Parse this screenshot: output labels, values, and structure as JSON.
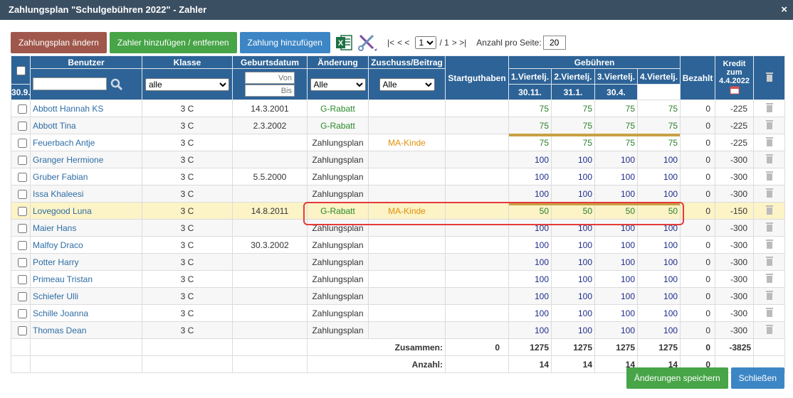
{
  "window": {
    "title": "Zahlungsplan \"Schulgebühren 2022\" - Zahler",
    "close_symbol": "×"
  },
  "toolbar": {
    "btn_change_plan": "Zahlungsplan ändern",
    "btn_add_remove": "Zahler hinzufügen / entfernen",
    "btn_add_payment": "Zahlung hinzufügen",
    "excel_icon": "excel-icon",
    "tools_icon": "tools-icon",
    "pager_first": "|<",
    "pager_prev": "< <",
    "page_current": "1",
    "page_total": "/ 1",
    "pager_next": "> >|",
    "per_page_label": "Anzahl pro Seite:",
    "per_page_value": "20"
  },
  "headers": {
    "benutzer": "Benutzer",
    "klasse": "Klasse",
    "geburtsdatum": "Geburtsdatum",
    "aenderung": "Änderung",
    "zuschuss": "Zuschuss/Beitrag",
    "startguthaben": "Startguthaben",
    "gebuehren": "Gebühren",
    "q1": "1.Viertelj.",
    "q1d": "30.9.",
    "q2": "2.Viertelj.",
    "q2d": "30.11.",
    "q3": "3.Viertelj.",
    "q3d": "31.1.",
    "q4": "4.Viertelj.",
    "q4d": "30.4.",
    "bezahlt": "Bezahlt",
    "kredit": "Kredit zum",
    "kredit_date": "4.4.2022"
  },
  "filters": {
    "klasse": "alle",
    "date_from": "Von",
    "date_to": "Bis",
    "aenderung": "Alle",
    "zuschuss": "Alle"
  },
  "rows": [
    {
      "name": "Abbott Hannah KS",
      "klasse": "3 C",
      "geb": "14.3.2001",
      "aend": "G-Rabatt",
      "zus": "",
      "q": [
        "75",
        "75",
        "75",
        "75"
      ],
      "bezahlt": "0",
      "kredit": "-225"
    },
    {
      "name": "Abbott Tina",
      "klasse": "3 C",
      "geb": "2.3.2002",
      "aend": "G-Rabatt",
      "zus": "",
      "q": [
        "75",
        "75",
        "75",
        "75"
      ],
      "bezahlt": "0",
      "kredit": "-225"
    },
    {
      "name": "Feuerbach Antje",
      "klasse": "3 C",
      "geb": "",
      "aend": "Zahlungsplan",
      "zus": "MA-Kinde",
      "q": [
        "75",
        "75",
        "75",
        "75"
      ],
      "bezahlt": "0",
      "kredit": "-225"
    },
    {
      "name": "Granger Hermione",
      "klasse": "3 C",
      "geb": "",
      "aend": "Zahlungsplan",
      "zus": "",
      "q": [
        "100",
        "100",
        "100",
        "100"
      ],
      "bezahlt": "0",
      "kredit": "-300"
    },
    {
      "name": "Gruber Fabian",
      "klasse": "3 C",
      "geb": "5.5.2000",
      "aend": "Zahlungsplan",
      "zus": "",
      "q": [
        "100",
        "100",
        "100",
        "100"
      ],
      "bezahlt": "0",
      "kredit": "-300"
    },
    {
      "name": "Issa Khaleesi",
      "klasse": "3 C",
      "geb": "",
      "aend": "Zahlungsplan",
      "zus": "",
      "q": [
        "100",
        "100",
        "100",
        "100"
      ],
      "bezahlt": "0",
      "kredit": "-300"
    },
    {
      "name": "Lovegood Luna",
      "klasse": "3 C",
      "geb": "14.8.2011",
      "aend": "G-Rabatt",
      "zus": "MA-Kinde",
      "q": [
        "50",
        "50",
        "50",
        "50"
      ],
      "bezahlt": "0",
      "kredit": "-150"
    },
    {
      "name": "Maier Hans",
      "klasse": "3 C",
      "geb": "",
      "aend": "Zahlungsplan",
      "zus": "",
      "q": [
        "100",
        "100",
        "100",
        "100"
      ],
      "bezahlt": "0",
      "kredit": "-300"
    },
    {
      "name": "Malfoy Draco",
      "klasse": "3 C",
      "geb": "30.3.2002",
      "aend": "Zahlungsplan",
      "zus": "",
      "q": [
        "100",
        "100",
        "100",
        "100"
      ],
      "bezahlt": "0",
      "kredit": "-300"
    },
    {
      "name": "Potter Harry",
      "klasse": "3 C",
      "geb": "",
      "aend": "Zahlungsplan",
      "zus": "",
      "q": [
        "100",
        "100",
        "100",
        "100"
      ],
      "bezahlt": "0",
      "kredit": "-300"
    },
    {
      "name": "Primeau Tristan",
      "klasse": "3 C",
      "geb": "",
      "aend": "Zahlungsplan",
      "zus": "",
      "q": [
        "100",
        "100",
        "100",
        "100"
      ],
      "bezahlt": "0",
      "kredit": "-300"
    },
    {
      "name": "Schiefer Ulli",
      "klasse": "3 C",
      "geb": "",
      "aend": "Zahlungsplan",
      "zus": "",
      "q": [
        "100",
        "100",
        "100",
        "100"
      ],
      "bezahlt": "0",
      "kredit": "-300"
    },
    {
      "name": "Schille Joanna",
      "klasse": "3 C",
      "geb": "",
      "aend": "Zahlungsplan",
      "zus": "",
      "q": [
        "100",
        "100",
        "100",
        "100"
      ],
      "bezahlt": "0",
      "kredit": "-300"
    },
    {
      "name": "Thomas Dean",
      "klasse": "3 C",
      "geb": "",
      "aend": "Zahlungsplan",
      "zus": "",
      "q": [
        "100",
        "100",
        "100",
        "100"
      ],
      "bezahlt": "0",
      "kredit": "-300"
    }
  ],
  "summary": {
    "total_label": "Zusammen:",
    "total_start": "0",
    "total_q": [
      "1275",
      "1275",
      "1275",
      "1275"
    ],
    "total_bezahlt": "0",
    "total_kredit": "-3825",
    "count_label": "Anzahl:",
    "count_q": [
      "14",
      "14",
      "14",
      "14"
    ],
    "count_bezahlt": "0"
  },
  "footer": {
    "save": "Änderungen speichern",
    "close": "Schließen"
  },
  "colors": {
    "header": "#2d6397",
    "title": "#3b4f63",
    "highlight_row": "#fcf3c6",
    "red_outline": "#e53a3a"
  }
}
